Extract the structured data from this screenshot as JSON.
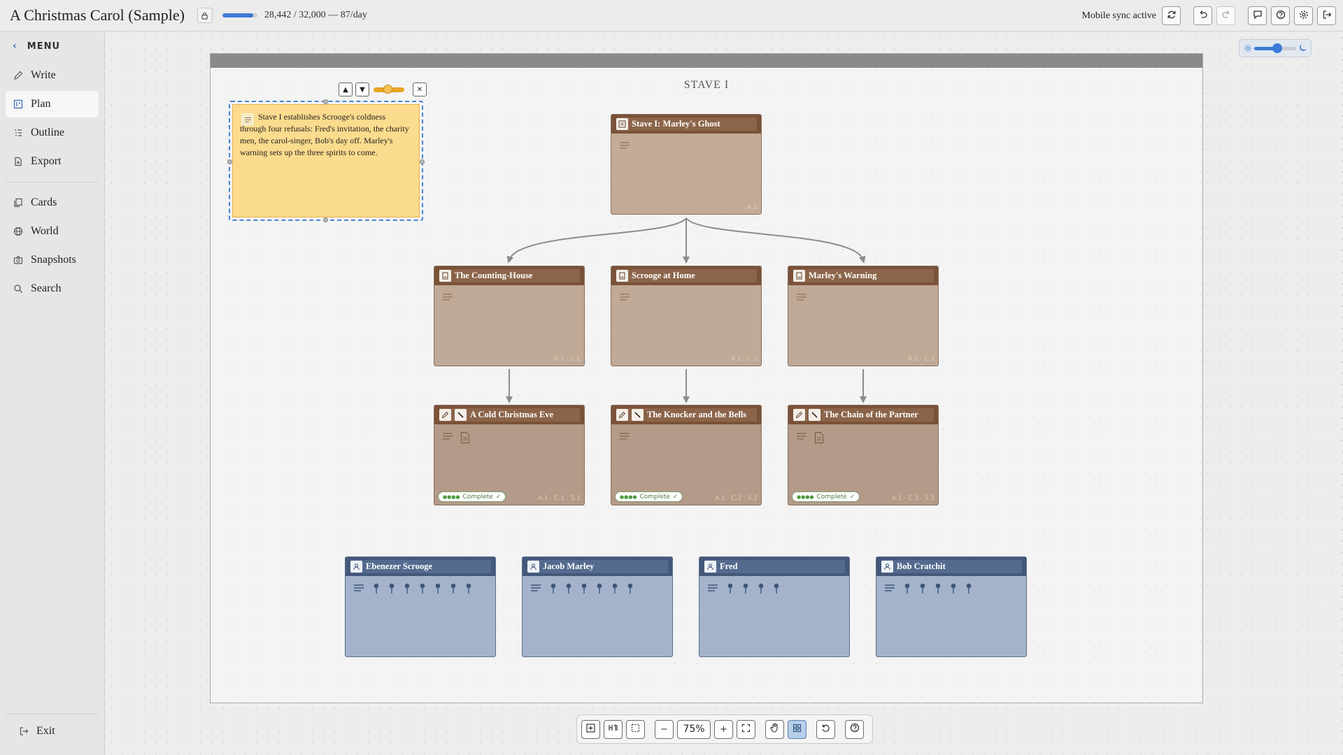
{
  "topbar": {
    "title": "A Christmas Carol (Sample)",
    "word_progress": 0.889,
    "word_count": "28,442 / 32,000 — 87/day",
    "sync_status": "Mobile sync active"
  },
  "sidebar": {
    "menu_label": "MENU",
    "items": [
      {
        "label": "Write",
        "icon": "pencil-icon"
      },
      {
        "label": "Plan",
        "icon": "board-icon",
        "active": true
      },
      {
        "label": "Outline",
        "icon": "outline-icon"
      },
      {
        "label": "Export",
        "icon": "export-icon"
      },
      {
        "label": "Cards",
        "icon": "cards-icon"
      },
      {
        "label": "World",
        "icon": "globe-icon"
      },
      {
        "label": "Snapshots",
        "icon": "camera-icon"
      },
      {
        "label": "Search",
        "icon": "search-icon"
      }
    ],
    "exit_label": "Exit"
  },
  "theme": {
    "level": 0.55
  },
  "board": {
    "title": "STAVE I",
    "note": {
      "text": "Stave I establishes Scrooge's coldness through four refusals: Fred's invitation, the charity men, the carol-singer, Bob's day off. Marley's warning sets up the three spirits to come."
    },
    "act": {
      "title": "Stave I: Marley's Ghost",
      "code": "A.1"
    },
    "chapters": [
      {
        "title": "The Counting-House",
        "code": "A.1 · C.1"
      },
      {
        "title": "Scrooge at Home",
        "code": "A.1 · C.2"
      },
      {
        "title": "Marley's Warning",
        "code": "A.1 · C.3"
      }
    ],
    "scenes": [
      {
        "title": "A Cold Christmas Eve",
        "code": "A.1 · C.1 · S.1",
        "status": "Complete"
      },
      {
        "title": "The Knocker and the Bells",
        "code": "A.1 · C.2 · S.2",
        "status": "Complete"
      },
      {
        "title": "The Chain of the Partner",
        "code": "A.1 · C.3 · S.3",
        "status": "Complete"
      }
    ],
    "characters": [
      {
        "name": "Ebenezer Scrooge",
        "pins": 7
      },
      {
        "name": "Jacob Marley",
        "pins": 6
      },
      {
        "name": "Fred",
        "pins": 4
      },
      {
        "name": "Bob Cratchit",
        "pins": 5
      }
    ]
  },
  "toolbar": {
    "zoom": "75%"
  },
  "colors": {
    "accent": "#3d7bd8",
    "act_header": "#7a5238",
    "character_header": "#44587a",
    "note_bg": "#fbdb8d",
    "complete_green": "#4d7b3c"
  }
}
